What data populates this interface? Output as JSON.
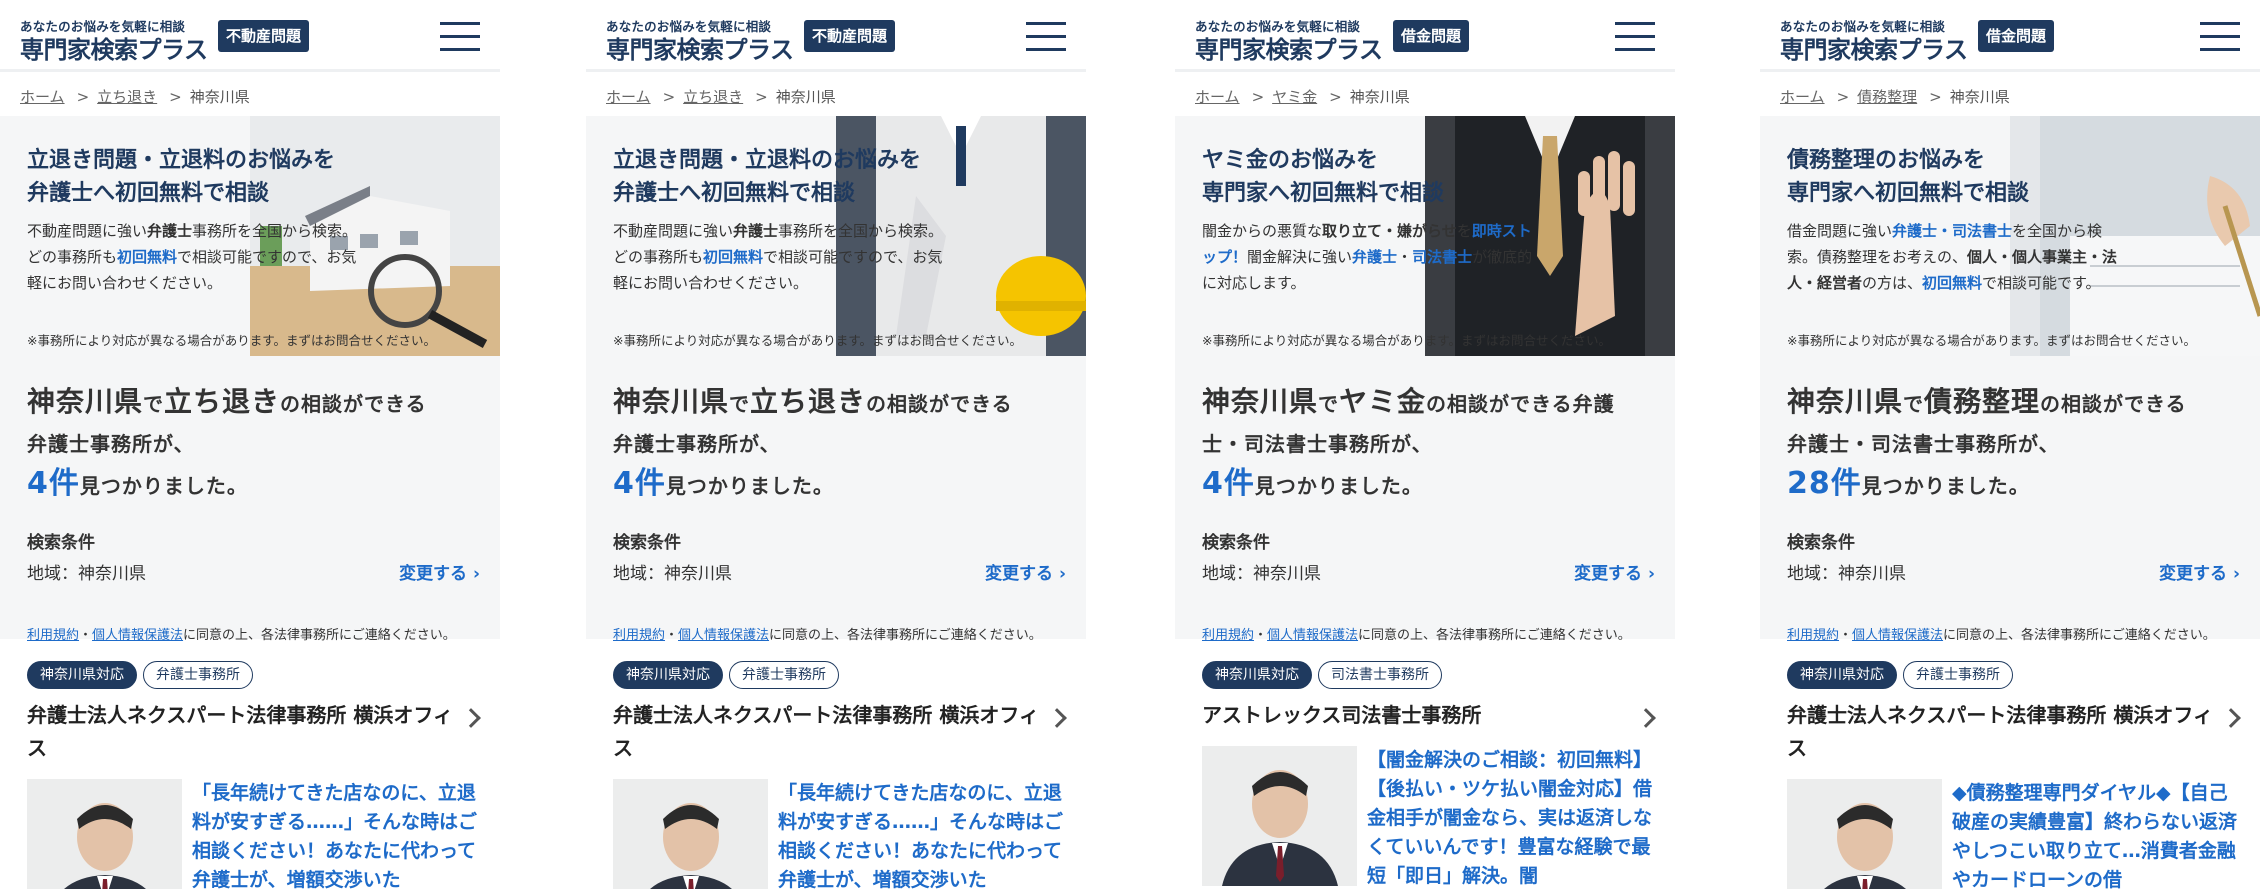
{
  "header": {
    "tagline": "あなたのお悩みを気軽に相談",
    "brand": "専門家検索プラス"
  },
  "icons": {
    "menu": "hamburger-menu-icon",
    "chevron": "chevron-right-icon"
  },
  "colors": {
    "navy": "#1f3a5f",
    "accent_blue": "#1e6bc9"
  },
  "panels": [
    {
      "category_badge": "不動産問題",
      "breadcrumb": [
        "ホーム",
        "立ち退き",
        "神奈川県"
      ],
      "hero_title_1": "立退き問題・立退料のお悩みを",
      "hero_title_2": "弁護士へ初回無料で相談",
      "hero_text": [
        "不動産問題に強い",
        "弁護士",
        "事務所を全国から検索。どの事務所も",
        "初回無料",
        "で相談可能ですので、お気軽にお問い合わせください。"
      ],
      "hero_note": "※事務所により対応が異なる場合があります。まずはお問合せください。",
      "region": "神奈川県",
      "topic": "立ち退き",
      "result_suffix": "の相談ができる",
      "result_line2": "弁護士事務所が、",
      "count": "4件",
      "found": "見つかりました。",
      "cond_label": "検索条件",
      "cond_value": "地域：神奈川県",
      "change": "変更する",
      "terms": [
        "利用規約",
        "・",
        "個人情報保護法",
        "に同意の上、各法律事務所にご連絡ください。"
      ],
      "tags": [
        "神奈川県対応",
        "弁護士事務所"
      ],
      "office": "弁護士法人ネクスパート法律事務所 横浜オフィス",
      "catch": "「長年続けてきた店なのに、立退料が安すぎる……」そんな時はご相談ください！あなたに代わって弁護士が、増額交渉いた"
    },
    {
      "category_badge": "不動産問題",
      "breadcrumb": [
        "ホーム",
        "立ち退き",
        "神奈川県"
      ],
      "hero_title_1": "立退き問題・立退料のお悩みを",
      "hero_title_2": "弁護士へ初回無料で相談",
      "hero_text": [
        "不動産問題に強い",
        "弁護士",
        "事務所を全国から検索。どの事務所も",
        "初回無料",
        "で相談可能ですので、お気軽にお問い合わせください。"
      ],
      "hero_note": "※事務所により対応が異なる場合があります。まずはお問合せください。",
      "region": "神奈川県",
      "topic": "立ち退き",
      "result_suffix": "の相談ができる",
      "result_line2": "弁護士事務所が、",
      "count": "4件",
      "found": "見つかりました。",
      "cond_label": "検索条件",
      "cond_value": "地域：神奈川県",
      "change": "変更する",
      "terms": [
        "利用規約",
        "・",
        "個人情報保護法",
        "に同意の上、各法律事務所にご連絡ください。"
      ],
      "tags": [
        "神奈川県対応",
        "弁護士事務所"
      ],
      "office": "弁護士法人ネクスパート法律事務所 横浜オフィス",
      "catch": "「長年続けてきた店なのに、立退料が安すぎる……」そんな時はご相談ください！あなたに代わって弁護士が、増額交渉いた"
    },
    {
      "category_badge": "借金問題",
      "breadcrumb": [
        "ホーム",
        "ヤミ金",
        "神奈川県"
      ],
      "hero_title_1": "ヤミ金のお悩みを",
      "hero_title_2": "専門家へ初回無料で相談",
      "hero_text": [
        "闇金からの悪質な",
        "取り立て・嫌がらせ",
        "を",
        "即時ストップ！",
        "闇金解決に強い",
        "弁護士",
        "・",
        "司法書士",
        "が徹底的に対応します。"
      ],
      "hero_note": "※事務所により対応が異なる場合があります。まずはお問合せください。",
      "region": "神奈川県",
      "topic": "ヤミ金",
      "result_suffix": "の相談ができる弁護",
      "result_line2": "士・司法書士事務所が、",
      "count": "4件",
      "found": "見つかりました。",
      "cond_label": "検索条件",
      "cond_value": "地域：神奈川県",
      "change": "変更する",
      "terms": [
        "利用規約",
        "・",
        "個人情報保護法",
        "に同意の上、各法律事務所にご連絡ください。"
      ],
      "tags": [
        "神奈川県対応",
        "司法書士事務所"
      ],
      "office": "アストレックス司法書士事務所",
      "catch": "【闇金解決のご相談：初回無料】【後払い・ツケ払い闇金対応】借金相手が闇金なら、実は返済しなくていいんです！豊富な経験で最短「即日」解決。闇"
    },
    {
      "category_badge": "借金問題",
      "breadcrumb": [
        "ホーム",
        "債務整理",
        "神奈川県"
      ],
      "hero_title_1": "債務整理のお悩みを",
      "hero_title_2": "専門家へ初回無料で相談",
      "hero_text": [
        "借金問題に強い",
        "弁護士・司法書士",
        "を全国から検索。債務整理をお考えの、",
        "個人・個人事業主・法人・経営者",
        "の方は、",
        "初回無料",
        "で相談可能です。"
      ],
      "hero_note": "※事務所により対応が異なる場合があります。まずはお問合せください。",
      "region": "神奈川県",
      "topic": "債務整理",
      "result_suffix": "の相談ができる",
      "result_line2": "弁護士・司法書士事務所が、",
      "count": "28件",
      "found": "見つかりました。",
      "cond_label": "検索条件",
      "cond_value": "地域：神奈川県",
      "change": "変更する",
      "terms": [
        "利用規約",
        "・",
        "個人情報保護法",
        "に同意の上、各法律事務所にご連絡ください。"
      ],
      "tags": [
        "神奈川県対応",
        "弁護士事務所"
      ],
      "office": "弁護士法人ネクスパート法律事務所 横浜オフィス",
      "catch": "◆債務整理専門ダイヤル◆【自己破産の実績豊富】終わらない返済やしつこい取り立て…消費者金融やカードローンの借"
    }
  ]
}
